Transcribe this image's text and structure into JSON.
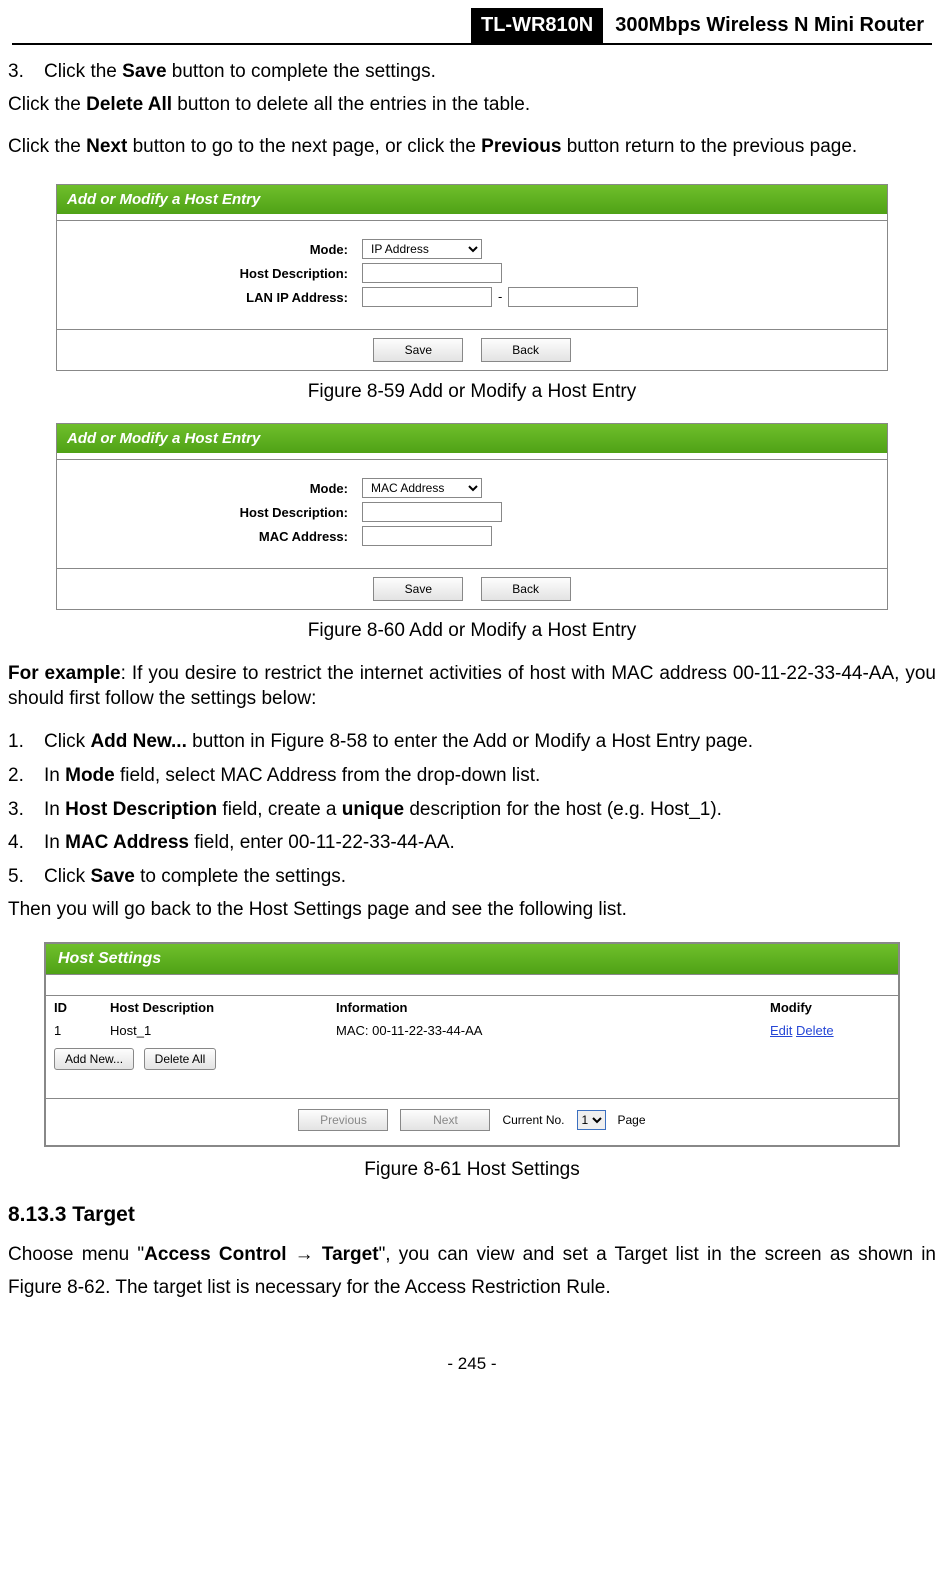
{
  "header": {
    "model": "TL-WR810N",
    "desc": "300Mbps Wireless N Mini Router"
  },
  "step3": {
    "num": "3.",
    "pre": "Click the ",
    "b": "Save",
    "post": " button to complete the settings."
  },
  "para_delete": {
    "t1": "Click the ",
    "b1": "Delete All",
    "t2": " button to delete all the entries in the table."
  },
  "para_next": {
    "t1": "Click the ",
    "b1": "Next",
    "t2": " button to go to the next page, or click the ",
    "b2": "Previous",
    "t3": " button return to the previous page."
  },
  "panel1": {
    "title": "Add or Modify a Host Entry",
    "l_mode": "Mode:",
    "l_host": "Host Description:",
    "l_lan": "LAN IP Address:",
    "opt_mode": "IP Address",
    "btn_save": "Save",
    "btn_back": "Back"
  },
  "cap1": "Figure 8-59 Add or Modify a Host Entry",
  "panel2": {
    "title": "Add or Modify a Host Entry",
    "l_mode": "Mode:",
    "l_host": "Host Description:",
    "l_mac": "MAC Address:",
    "opt_mode": "MAC Address",
    "btn_save": "Save",
    "btn_back": "Back"
  },
  "cap2": "Figure 8-60 Add or Modify a Host Entry",
  "example_para": {
    "lead": "For example",
    "rest": ": If you desire to restrict the internet activities of host with MAC address 00-11-22-33-44-AA, you should first follow the settings below:"
  },
  "ex_steps": {
    "s1": {
      "n": "1.",
      "t1": "Click ",
      "b": "Add New...",
      "t2": " button in Figure 8-58 to enter the Add or Modify a Host Entry page."
    },
    "s2": {
      "n": "2.",
      "t1": "In ",
      "b": "Mode",
      "t2": " field, select MAC Address from the drop-down list."
    },
    "s3": {
      "n": "3.",
      "t1": "In ",
      "b1": "Host Description",
      "t2": " field, create a ",
      "b2": "unique",
      "t3": " description for the host (e.g. Host_1)."
    },
    "s4": {
      "n": "4.",
      "t1": "In ",
      "b": "MAC Address",
      "t2": " field, enter 00-11-22-33-44-AA."
    },
    "s5": {
      "n": "5.",
      "t1": "Click ",
      "b": "Save",
      "t2": " to complete the settings."
    }
  },
  "then_para": "Then you will go back to the Host Settings page and see the following list.",
  "host_panel": {
    "title": "Host Settings",
    "cols": {
      "id": "ID",
      "desc": "Host Description",
      "info": "Information",
      "mod": "Modify"
    },
    "row": {
      "id": "1",
      "desc": "Host_1",
      "info": "MAC: 00-11-22-33-44-AA",
      "edit": "Edit",
      "del": "Delete"
    },
    "btn_add": "Add New...",
    "btn_delall": "Delete All",
    "prev": "Previous",
    "next": "Next",
    "cur_lbl": "Current No.",
    "cur_opt": "1",
    "page": "Page"
  },
  "cap3": "Figure 8-61 Host Settings",
  "section": "8.13.3 Target",
  "target_para": {
    "t1": "Choose menu \"",
    "b1": "Access Control",
    "arrow": " → ",
    "b2": "Target",
    "t2": "\", you can view and set a Target list in the screen as shown in Figure 8-62. The target list is necessary for the Access Restriction Rule."
  },
  "footer": "- 245 -"
}
